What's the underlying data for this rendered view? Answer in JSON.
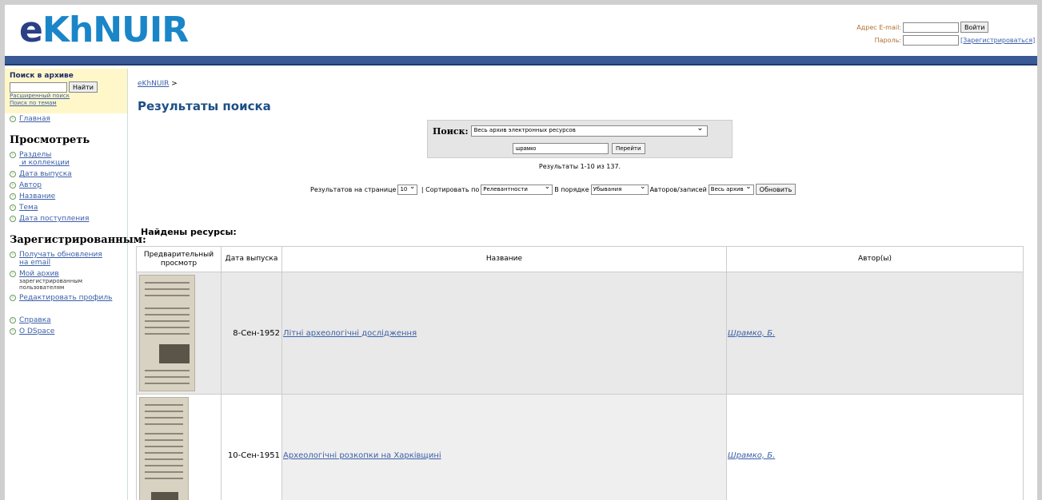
{
  "header": {
    "logo_part1": "e",
    "logo_part2": "KhNUIR",
    "email_label": "Адрес E-mail:",
    "password_label": "Пароль:",
    "login_button": "Войти",
    "register_link": "[Зарегистрироваться]"
  },
  "sidebar": {
    "search_title": "Поиск в архиве",
    "search_button": "Найти",
    "advanced_link": "Расширенный поиск",
    "by_topic_link": "Поиск по темам",
    "home_link": "Главная",
    "browse_heading": "Просмотреть",
    "browse_items": [
      {
        "label": "Разделы",
        "label2": "и коллекции"
      },
      {
        "label": "Дата выпуска"
      },
      {
        "label": "Автор"
      },
      {
        "label": "Название"
      },
      {
        "label": "Тема"
      },
      {
        "label": "Дата поступления"
      }
    ],
    "registered_heading": "Зарегистрированным:",
    "registered_items": [
      {
        "label": "Получать обновления",
        "label2": "на email"
      },
      {
        "label": "Мой архив",
        "sub": "зарегистрированным пользователям"
      },
      {
        "label": "Редактировать профиль"
      }
    ],
    "help_link": "Справка",
    "about_link": "О DSpace"
  },
  "main": {
    "breadcrumb": "eKhNUIR",
    "breadcrumb_sep": ">",
    "title": "Результаты поиска",
    "search_label": "Поиск:",
    "scope_value": "Весь архив электронных ресурсов",
    "query_value": "шрамко",
    "go_button": "Перейти",
    "count_text": "Результаты 1-10 из 137.",
    "options": {
      "per_page_label": "Результатов на странице",
      "per_page_value": "10",
      "sort_label": "Сортировать по",
      "sort_value": "Релевантности",
      "order_label": "В порядке",
      "order_value": "Убывания",
      "authors_label": "Авторов/записей",
      "authors_value": "Весь архив",
      "update_button": "Обновить"
    },
    "found_heading": "Найдены ресурсы:",
    "table": {
      "col_preview": "Предварительный просмотр",
      "col_date": "Дата выпуска",
      "col_title": "Название",
      "col_authors": "Автор(ы)",
      "rows": [
        {
          "date": "8-Сен-1952",
          "title": "Літні археологічні дослідження",
          "author": "Шрамко, Б."
        },
        {
          "date": "10-Сен-1951",
          "title": "Археологічні розкопки на Харківщині",
          "author": "Шрамко, Б."
        }
      ]
    }
  }
}
